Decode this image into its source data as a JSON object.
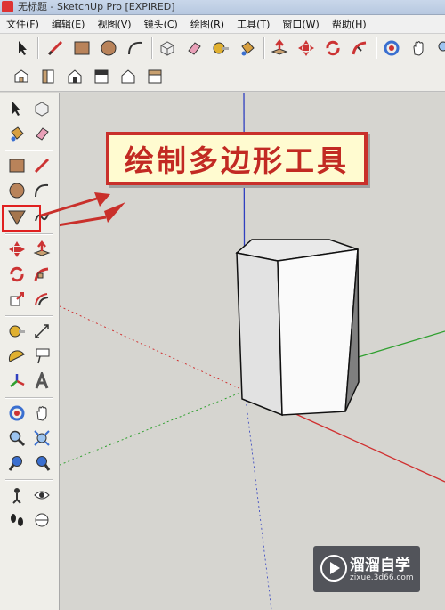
{
  "window": {
    "title": "无标题 - SketchUp Pro [EXPIRED]"
  },
  "menu": [
    "文件(F)",
    "编辑(E)",
    "视图(V)",
    "镜头(C)",
    "绘图(R)",
    "工具(T)",
    "窗口(W)",
    "帮助(H)"
  ],
  "callout": {
    "text": "绘制多边形工具",
    "color": "#c22a23"
  },
  "watermark": {
    "title": "溜溜自学",
    "url": "zixue.3d66.com"
  },
  "colors": {
    "axis_red": "#d03030",
    "axis_green": "#30a030",
    "axis_blue": "#3040c0",
    "viewport": "#d6d5d0"
  }
}
